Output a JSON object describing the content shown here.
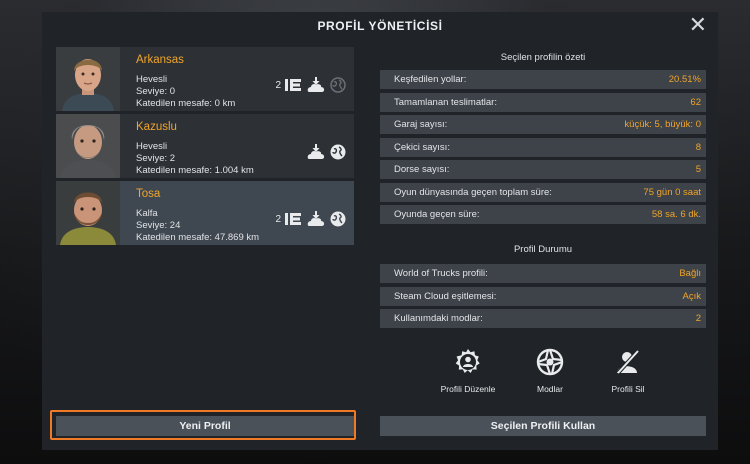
{
  "dialog": {
    "title": "PROFİL YÖNETİCİSİ",
    "close_label": "✕"
  },
  "profiles": [
    {
      "name": "Arkansas",
      "rank": "Hevesli",
      "level": "Seviye: 0",
      "distance": "Katedilen mesafe: 0 km",
      "count": "2",
      "selected": false
    },
    {
      "name": "Kazuslu",
      "rank": "Hevesli",
      "level": "Seviye: 2",
      "distance": "Katedilen mesafe: 1.004 km",
      "count": "",
      "selected": false
    },
    {
      "name": "Tosa",
      "rank": "Kalfa",
      "level": "Seviye: 24",
      "distance": "Katedilen mesafe: 47.869 km",
      "count": "2",
      "selected": true
    }
  ],
  "summary": {
    "title": "Seçilen profilin özeti",
    "rows": [
      {
        "label": "Keşfedilen yollar:",
        "value": "20.51%"
      },
      {
        "label": "Tamamlanan teslimatlar:",
        "value": "62"
      },
      {
        "label": "Garaj sayısı:",
        "value": "küçük: 5, büyük: 0"
      },
      {
        "label": "Çekici sayısı:",
        "value": "8"
      },
      {
        "label": "Dorse sayısı:",
        "value": "5"
      },
      {
        "label": "Oyun dünyasında geçen toplam süre:",
        "value": "75 gün 0 saat"
      },
      {
        "label": "Oyunda geçen süre:",
        "value": "58 sa. 6 dk."
      }
    ]
  },
  "status": {
    "title": "Profil Durumu",
    "rows": [
      {
        "label": "World of Trucks profili:",
        "value": "Bağlı"
      },
      {
        "label": "Steam Cloud eşitlemesi:",
        "value": "Açık"
      },
      {
        "label": "Kullanımdaki modlar:",
        "value": "2"
      }
    ]
  },
  "actions": {
    "edit_label": "Profili Düzenle",
    "mods_label": "Modlar",
    "delete_label": "Profili Sil"
  },
  "buttons": {
    "new_profile": "Yeni Profil",
    "use_selected": "Seçilen Profili Kullan"
  },
  "colors": {
    "accent": "#f0a52a",
    "focus_outline": "#f07a26",
    "selected_row": "#3f4750",
    "row": "#2d3136"
  },
  "icons": [
    "close-icon",
    "wot-logo-icon",
    "cloud-download-icon",
    "globe-icon",
    "gear-user-icon",
    "mods-icon",
    "user-remove-icon"
  ]
}
